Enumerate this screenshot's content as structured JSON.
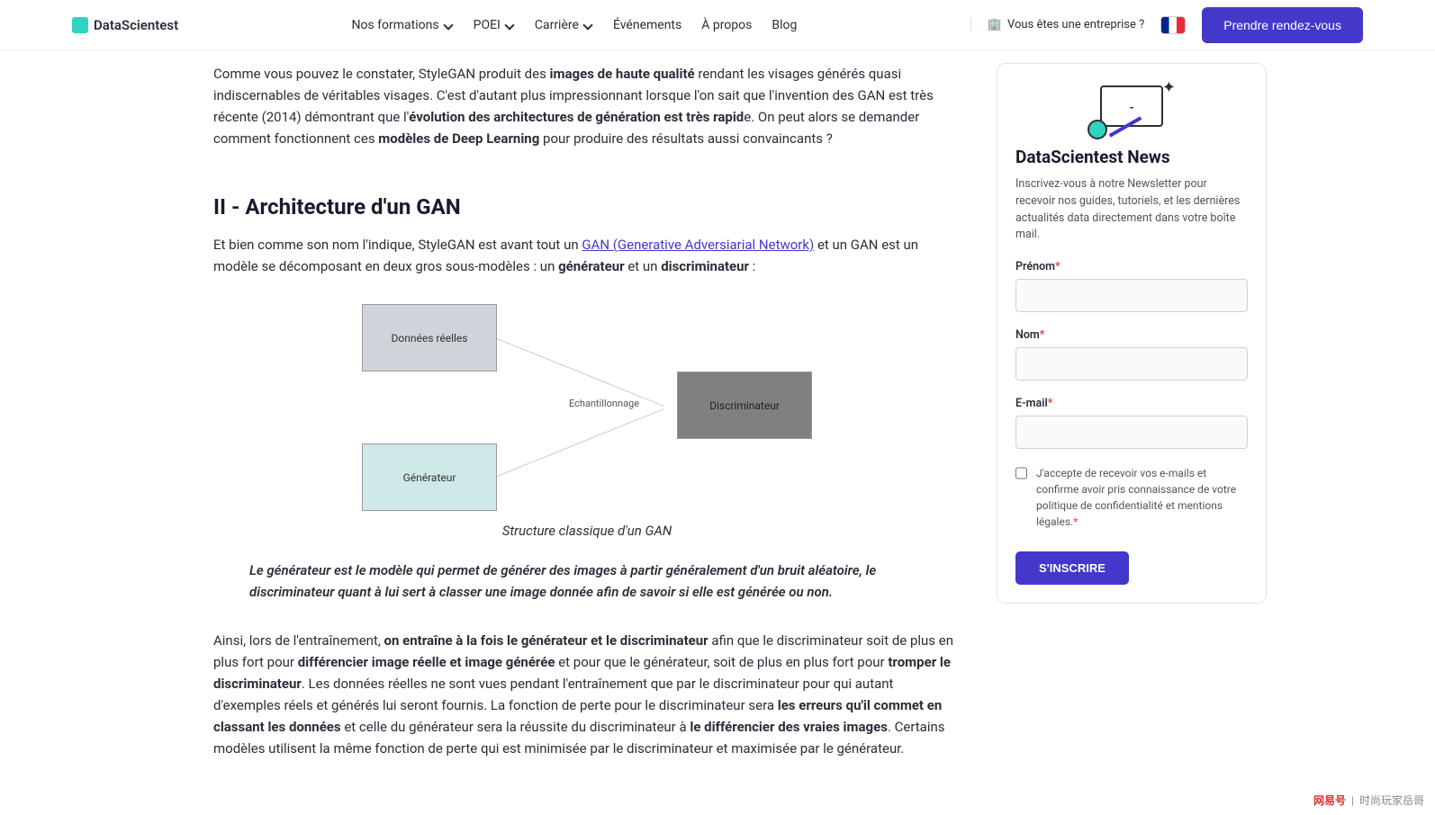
{
  "header": {
    "logo_text": "DataScientest",
    "nav": {
      "formations": "Nos formations",
      "poei": "POEI",
      "carriere": "Carrière",
      "evenements": "Événements",
      "apropos": "À propos",
      "blog": "Blog"
    },
    "enterprise_text": "Vous êtes une entreprise ?",
    "cta": "Prendre rendez-vous"
  },
  "article": {
    "p1_a": "Comme vous pouvez le constater, StyleGAN produit des ",
    "p1_b": "images de haute qualité",
    "p1_c": " rendant les visages générés quasi indiscernables de véritables visages. C'est d'autant plus impressionnant lorsque l'on sait que l'invention des GAN est très récente (2014) démontrant que l'",
    "p1_d": "évolution des architectures de génération est très rapid",
    "p1_e": "e. On peut alors se demander comment fonctionnent ces ",
    "p1_f": "modèles de Deep Learning",
    "p1_g": " pour produire des résultats aussi convaincants ?",
    "h2": "II - Architecture d'un GAN",
    "p2_a": "Et bien comme son nom l'indique, StyleGAN est avant tout un ",
    "p2_link": "GAN (Generative Adversiarial Network)",
    "p2_b": " et un GAN est un modèle se décomposant en deux gros sous-modèles : un ",
    "p2_c": "générateur",
    "p2_d": " et un ",
    "p2_e": "discriminateur",
    "p2_f": " :",
    "diagram": {
      "real": "Données réelles",
      "generator": "Générateur",
      "discriminator": "Discriminateur",
      "sampling": "Echantillonnage"
    },
    "caption": "Structure classique d'un GAN",
    "quote": "Le générateur est le modèle qui permet de générer des images à partir généralement d'un bruit aléatoire, le discriminateur quant à lui sert à classer une image donnée afin de savoir si elle est générée ou non.",
    "p3_a": "Ainsi, lors de l'entraînement, ",
    "p3_b": "on entraîne à la fois le générateur et le discriminateur",
    "p3_c": " afin que le discriminateur soit de plus en plus fort pour ",
    "p3_d": "différencier image réelle et image générée",
    "p3_e": " et pour que le générateur, soit de plus en plus fort pour ",
    "p3_f": "tromper le discriminateur",
    "p3_g": ". Les données réelles ne sont vues pendant l'entraînement que par le discriminateur pour qui autant d'exemples réels et générés lui seront fournis. La fonction de perte pour le discriminateur sera ",
    "p3_h": "les erreurs qu'il commet en classant les données",
    "p3_i": " et celle du générateur sera la réussite du discriminateur à ",
    "p3_j": "le différencier des vraies images",
    "p3_k": ". Certains modèles utilisent la même fonction de perte qui est minimisée par le discriminateur et maximisée par le générateur."
  },
  "sidebar": {
    "title": "DataScientest News",
    "desc": "Inscrivez-vous à notre Newsletter pour recevoir nos guides, tutoriels, et les dernières actualités data directement dans votre boîte mail.",
    "prenom": "Prénom",
    "nom": "Nom",
    "email": "E-mail",
    "consent": "J'accepte de recevoir vos e-mails et confirme avoir pris connaissance de votre politique de confidentialité et mentions légales.",
    "submit": "S'INSCRIRE"
  },
  "footermark": {
    "brand": "网易号",
    "author": "时尚玩家岳哥"
  }
}
